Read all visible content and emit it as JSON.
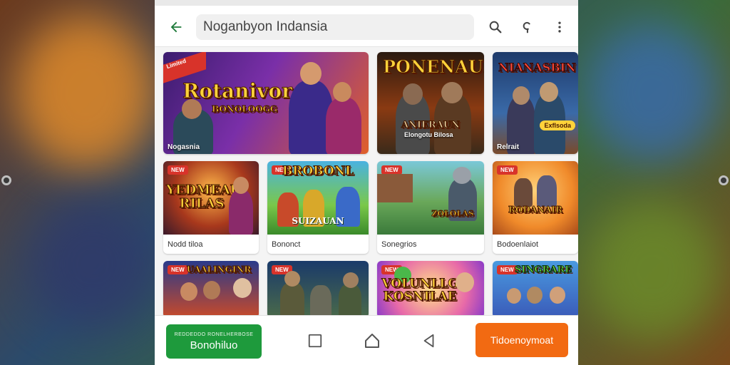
{
  "search": {
    "query": "Noganbyon Indansia"
  },
  "icons": {
    "back": "arrow-left-icon",
    "search": "search-icon",
    "voice": "voice-search-icon",
    "more": "more-vert-icon"
  },
  "featured": [
    {
      "title": "Rotanivor",
      "subtitle": "BONOLOOGG",
      "label": "Nogasnia",
      "ribbon": "Limited"
    },
    {
      "title": "PONENAUN",
      "subtitle": "ANIERAUN",
      "label": "Elongotu Bilosa"
    },
    {
      "title": "NIANASBIN",
      "label": "Relrait",
      "tag": "Exflsoda"
    }
  ],
  "row2": [
    {
      "badge": "NEW",
      "title": "YEDMEAU RILAS",
      "caption": "Nodd tiloa"
    },
    {
      "badge": "NEW",
      "title": "BROBONL",
      "subtitle": "SUIZAUAN",
      "caption": "Bononct"
    },
    {
      "badge": "NEW",
      "title": "ZOLOLAS",
      "caption": "Sonegrios"
    },
    {
      "badge": "NEW",
      "title": "RODANAIR",
      "caption": "Bodoenlaiot"
    }
  ],
  "row3": [
    {
      "badge": "NEW",
      "title": "UAALINGINR"
    },
    {
      "badge": "NEW",
      "title": ""
    },
    {
      "badge": "NEW",
      "title": "VOLUNLLG KOSNILAE"
    },
    {
      "badge": "NEW",
      "title": "SINGRARE"
    }
  ],
  "bottom": {
    "green_small": "REDDEDDO RONELHERBOSE",
    "green_label": "Bonohiluo",
    "orange_label": "Tidoenoymoat",
    "keys": [
      "recent-apps-icon",
      "home-icon",
      "back-nav-icon"
    ]
  },
  "colors": {
    "green": "#1e9a3c",
    "orange": "#f26a12",
    "accent": "#2a7a3a"
  }
}
